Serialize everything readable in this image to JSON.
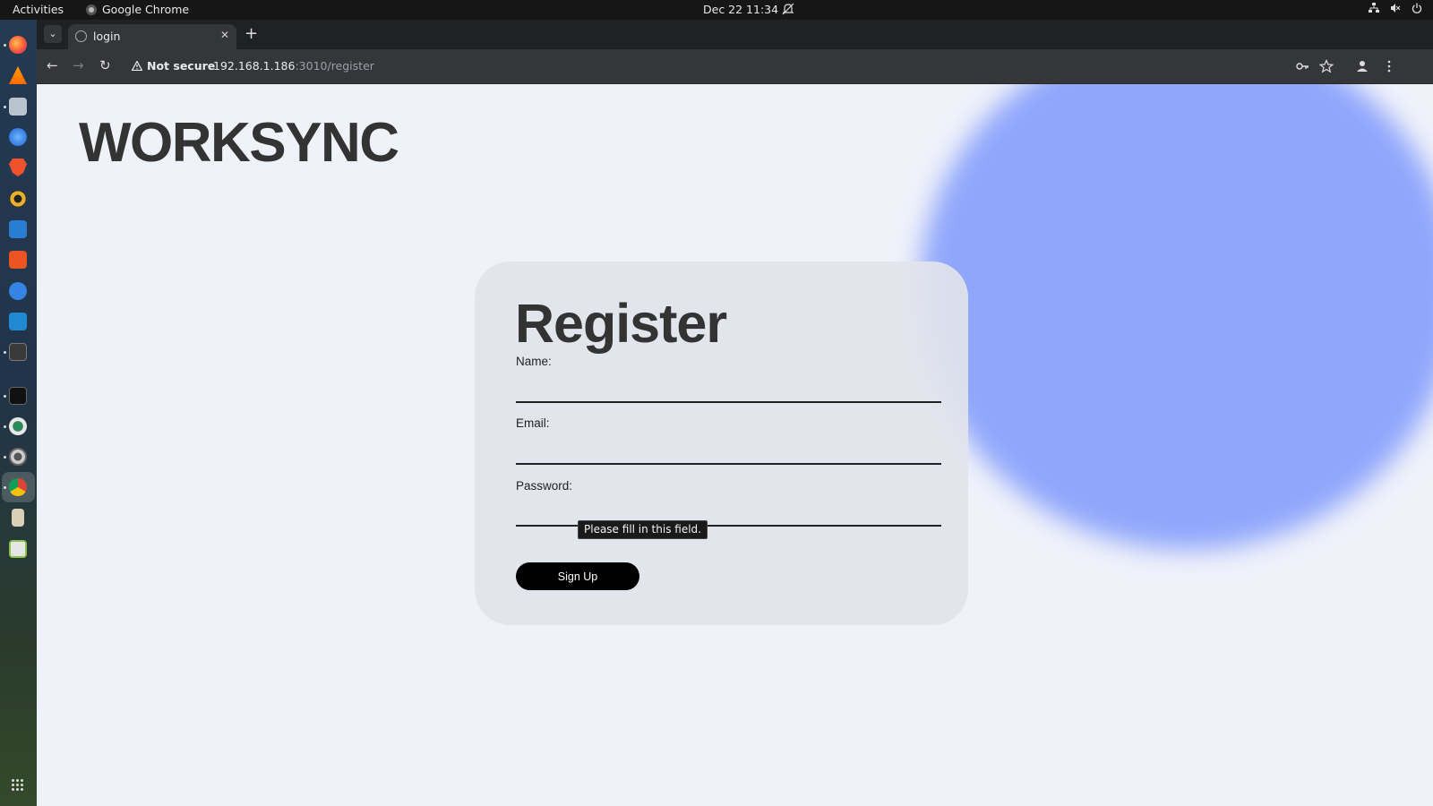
{
  "system_bar": {
    "activities": "Activities",
    "app_name": "Google Chrome",
    "clock": "Dec 22  11:34"
  },
  "browser": {
    "tab_title": "login",
    "url_security": "Not secure",
    "url_host": "192.168.1.186",
    "url_path": ":3010/register"
  },
  "page": {
    "brand": "WORKSYNC",
    "form": {
      "title": "Register",
      "name_label": "Name:",
      "name_value": "",
      "email_label": "Email:",
      "email_value": "",
      "password_label": "Password:",
      "password_value": "",
      "submit_label": "Sign Up",
      "validation_tooltip": "Please fill in this field."
    }
  },
  "colors": {
    "page_bg": "#f0f2fa",
    "blob": "#8fa6fb",
    "card_bg": "#e2e4eb",
    "button_bg": "#000000"
  },
  "dock_icons": [
    "firefox-icon",
    "vlc-icon",
    "files-icon",
    "thunderbird-icon",
    "brave-icon",
    "rhythmbox-icon",
    "writer-icon",
    "app-center-icon",
    "help-icon",
    "vscode-icon",
    "terminal-icon",
    "app-icon",
    "app-icon-2",
    "settings-icon",
    "chrome-icon",
    "archive-icon",
    "trash-icon",
    "show-apps-icon"
  ]
}
